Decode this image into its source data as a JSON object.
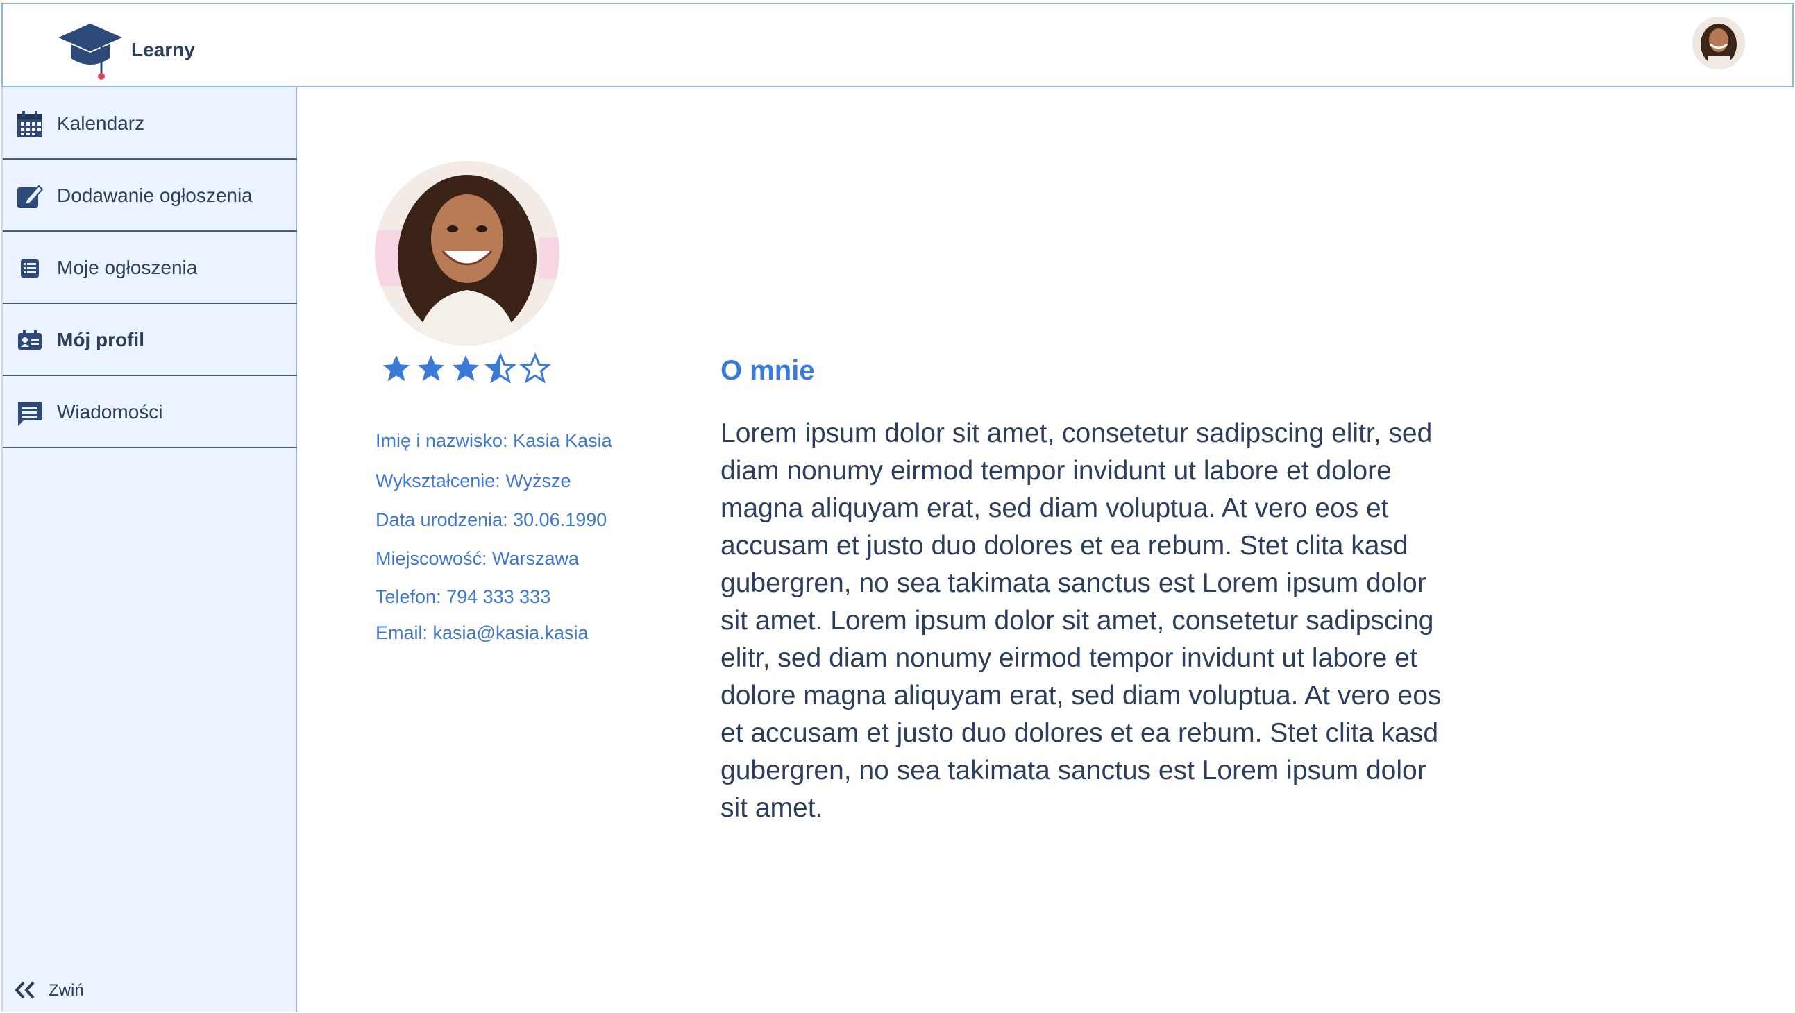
{
  "app": {
    "name": "Learny"
  },
  "sidebar": {
    "items": [
      {
        "label": "Kalendarz",
        "icon": "calendar-icon"
      },
      {
        "label": "Dodawanie ogłoszenia",
        "icon": "edit-icon"
      },
      {
        "label": "Moje ogłoszenia",
        "icon": "list-icon"
      },
      {
        "label": "Mój profil",
        "icon": "profile-card-icon",
        "active": true
      },
      {
        "label": "Wiadomości",
        "icon": "message-icon"
      }
    ],
    "collapse_label": "Zwiń"
  },
  "profile": {
    "rating": 3.5,
    "rating_max": 5,
    "details": [
      "Imię i nazwisko: Kasia Kasia",
      "Wykształcenie: Wyższe",
      "Data urodzenia: 30.06.1990",
      "Miejscowość: Warszawa",
      "Telefon: 794 333 333",
      "Email: kasia@kasia.kasia"
    ]
  },
  "about": {
    "title": "O mnie",
    "text": "Lorem ipsum dolor sit amet, consetetur sadipscing elitr, sed diam nonumy eirmod tempor invidunt ut labore et dolore magna aliquyam erat, sed diam voluptua. At vero eos et accusam et justo duo dolores et ea rebum. Stet clita kasd gubergren, no sea takimata sanctus est Lorem ipsum dolor sit amet. Lorem ipsum dolor sit amet, consetetur sadipscing elitr, sed diam nonumy eirmod tempor invidunt ut labore et dolore magna aliquyam erat, sed diam voluptua. At vero eos et accusam et justo duo dolores et ea rebum. Stet clita kasd gubergren, no sea takimata sanctus est Lorem ipsum dolor sit amet."
  },
  "colors": {
    "accent": "#3b7ad6",
    "navy": "#2c3e5a",
    "sidebar_bg": "#eaf3ff",
    "header_border": "#8fb4de"
  }
}
